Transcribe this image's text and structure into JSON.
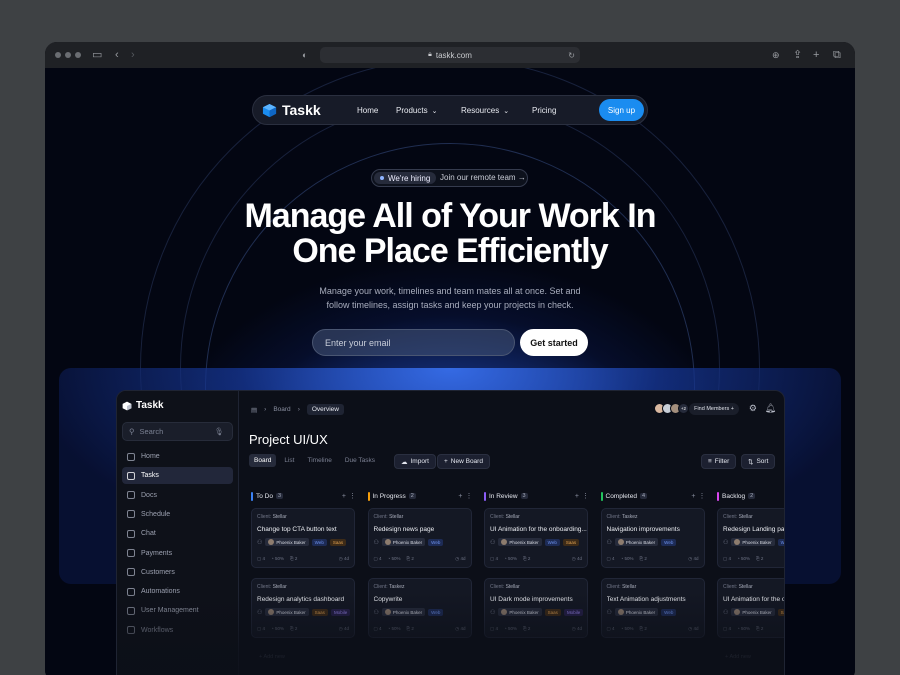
{
  "browser": {
    "url": "taskk.com"
  },
  "nav": {
    "brand": "Taskk",
    "links": [
      {
        "label": "Home"
      },
      {
        "label": "Products"
      },
      {
        "label": "Resources"
      },
      {
        "label": "Pricing"
      }
    ],
    "signup": "Sign up"
  },
  "hero": {
    "hiring_badge": "We're hiring",
    "hiring_link": "Join our remote team",
    "headline_line1": "Manage All of Your Work In",
    "headline_line2": "One Place Efficiently",
    "subtitle_line1": "Manage your work, timelines and team mates all at once. Set and",
    "subtitle_line2": "follow timelines, assign tasks and keep your projects in check.",
    "email_placeholder": "Enter your email",
    "cta": "Get started"
  },
  "app": {
    "brand": "Taskk",
    "search_placeholder": "Search",
    "sidebar": [
      {
        "label": "Home"
      },
      {
        "label": "Tasks",
        "active": true
      },
      {
        "label": "Docs"
      },
      {
        "label": "Schedule"
      },
      {
        "label": "Chat"
      },
      {
        "label": "Payments"
      },
      {
        "label": "Customers"
      },
      {
        "label": "Automations"
      },
      {
        "label": "User Management"
      },
      {
        "label": "Workflows"
      }
    ],
    "breadcrumb": {
      "parent": "Board",
      "current": "Overview"
    },
    "avatars_more": "+2",
    "find_members": "Find Members",
    "project_title": "Project UI/UX",
    "tabs": [
      {
        "label": "Board",
        "active": true
      },
      {
        "label": "List"
      },
      {
        "label": "Timeline"
      },
      {
        "label": "Due Tasks"
      }
    ],
    "import": "Import",
    "new_board": "New Board",
    "filter": "Filter",
    "sort": "Sort",
    "add_new": "Add new",
    "columns": [
      {
        "name": "To Do",
        "count": "3",
        "color": "#3b82f6",
        "cards": [
          {
            "client": "Stellar",
            "title": "Change top CTA button text",
            "user": "Phoenix Baker",
            "tags": [
              "Web",
              "Saas"
            ]
          },
          {
            "client": "Stellar",
            "title": "Redesign analytics dashboard",
            "user": "Phoenix Baker",
            "tags": [
              "Saas",
              "Mobile"
            ]
          }
        ]
      },
      {
        "name": "In Progress",
        "count": "2",
        "color": "#f59e0b",
        "cards": [
          {
            "client": "Stellar",
            "title": "Redesign news page",
            "user": "Phoenix Baker",
            "tags": [
              "Web"
            ]
          },
          {
            "client": "Taskez",
            "title": "Copywrite",
            "user": "Phoenix Baker",
            "tags": [
              "Web"
            ]
          }
        ]
      },
      {
        "name": "In Review",
        "count": "3",
        "color": "#8b5cf6",
        "cards": [
          {
            "client": "Stellar",
            "title": "UI Animation for the onboarding...",
            "user": "Phoenix Baker",
            "tags": [
              "Web",
              "Saas"
            ]
          },
          {
            "client": "Stellar",
            "title": "UI Dark mode improvements",
            "user": "Phoenix Baker",
            "tags": [
              "Saas",
              "Mobile"
            ]
          }
        ]
      },
      {
        "name": "Completed",
        "count": "4",
        "color": "#22c55e",
        "cards": [
          {
            "client": "Taskez",
            "title": "Navigation improvements",
            "user": "Phoenix Baker",
            "tags": [
              "Web"
            ]
          },
          {
            "client": "Stellar",
            "title": "Text Animation adjustments",
            "user": "Phoenix Baker",
            "tags": [
              "Web"
            ]
          }
        ]
      },
      {
        "name": "Backlog",
        "count": "2",
        "color": "#d946ef",
        "cards": [
          {
            "client": "Stellar",
            "title": "Redesign Landing page",
            "user": "Phoenix Baker",
            "tags": [
              "Web"
            ]
          },
          {
            "client": "Stellar",
            "title": "UI Animation for the on",
            "user": "Phoenix Baker",
            "tags": [
              "Saas"
            ]
          }
        ]
      }
    ],
    "card_stats": {
      "comments": "4",
      "progress": "50%",
      "files": "2",
      "days": "4d"
    }
  }
}
